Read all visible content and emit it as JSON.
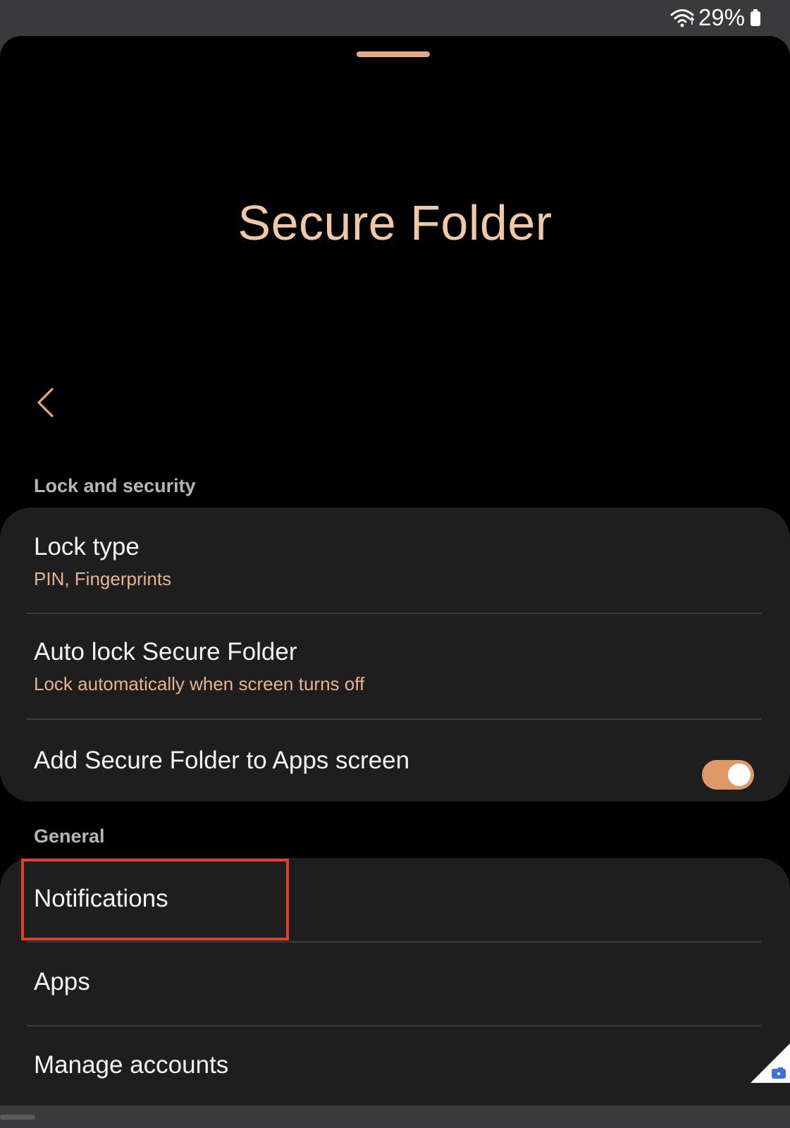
{
  "status_bar": {
    "battery_percent": "29%",
    "wifi_icon": "wifi-icon",
    "battery_icon": "battery-icon"
  },
  "header": {
    "title": "Secure Folder",
    "back_icon": "chevron-left-icon"
  },
  "sections": {
    "lock_and_security": {
      "label": "Lock and security",
      "lock_type": {
        "title": "Lock type",
        "subtitle": "PIN, Fingerprints"
      },
      "auto_lock": {
        "title": "Auto lock Secure Folder",
        "subtitle": "Lock automatically when screen turns off"
      },
      "add_to_apps": {
        "title": "Add Secure Folder to Apps screen",
        "toggle_on": true
      }
    },
    "general": {
      "label": "General",
      "items": [
        {
          "title": "Notifications"
        },
        {
          "title": "Apps"
        },
        {
          "title": "Manage accounts"
        }
      ]
    }
  },
  "colors": {
    "accent": "#e5a97e",
    "title": "#f0c8a8",
    "card_bg": "#1e1e1f",
    "highlight": "#e0402a"
  }
}
